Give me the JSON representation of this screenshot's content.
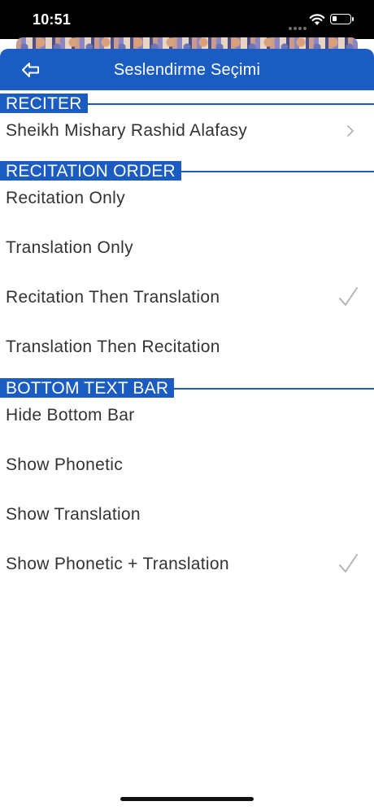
{
  "status_bar": {
    "time": "10:51"
  },
  "nav": {
    "title": "Seslendirme Seçimi"
  },
  "sections": {
    "reciter": {
      "header": "RECITER",
      "items": [
        {
          "label": "Sheikh Mishary Rashid Alafasy",
          "has_disclosure": true
        }
      ]
    },
    "recitation_order": {
      "header": "RECITATION ORDER",
      "items": [
        {
          "label": "Recitation Only",
          "selected": false
        },
        {
          "label": "Translation Only",
          "selected": false
        },
        {
          "label": "Recitation Then Translation",
          "selected": true
        },
        {
          "label": "Translation Then Recitation",
          "selected": false
        }
      ]
    },
    "bottom_text_bar": {
      "header": "BOTTOM TEXT BAR",
      "items": [
        {
          "label": "Hide Bottom Bar",
          "selected": false
        },
        {
          "label": "Show Phonetic",
          "selected": false
        },
        {
          "label": "Show Translation",
          "selected": false
        },
        {
          "label": "Show Phonetic + Translation",
          "selected": true
        }
      ]
    }
  },
  "colors": {
    "accent": "#1b5cc3",
    "text": "#333333",
    "check": "#b4b4b4"
  }
}
